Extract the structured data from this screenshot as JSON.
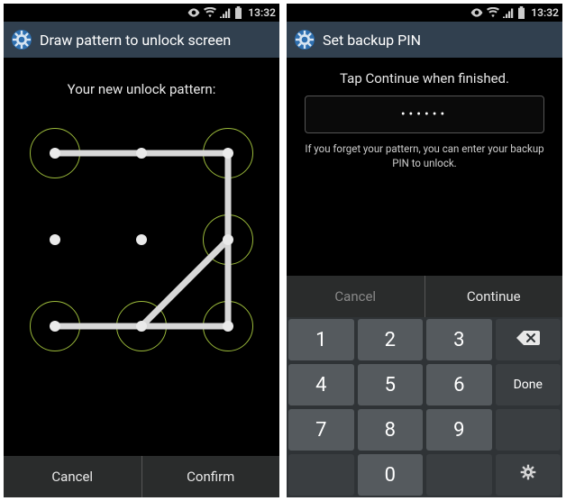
{
  "status": {
    "time": "13:32"
  },
  "left": {
    "header_title": "Draw pattern to unlock screen",
    "subtitle": "Your new unlock pattern:",
    "cancel": "Cancel",
    "confirm": "Confirm",
    "pattern_sequence": [
      1,
      3,
      9,
      7,
      8,
      6
    ],
    "active_nodes": [
      1,
      3,
      6,
      7,
      8,
      9
    ]
  },
  "right": {
    "header_title": "Set backup PIN",
    "subtitle": "Tap Continue when finished.",
    "pin_masked": "••••••",
    "hint": "If you forget your pattern, you can enter your backup PIN to unlock.",
    "cancel": "Cancel",
    "continue": "Continue",
    "keypad": {
      "k1": "1",
      "k2": "2",
      "k3": "3",
      "k4": "4",
      "k5": "5",
      "k6": "6",
      "k7": "7",
      "k8": "8",
      "k9": "9",
      "k0": "0",
      "done": "Done"
    }
  }
}
